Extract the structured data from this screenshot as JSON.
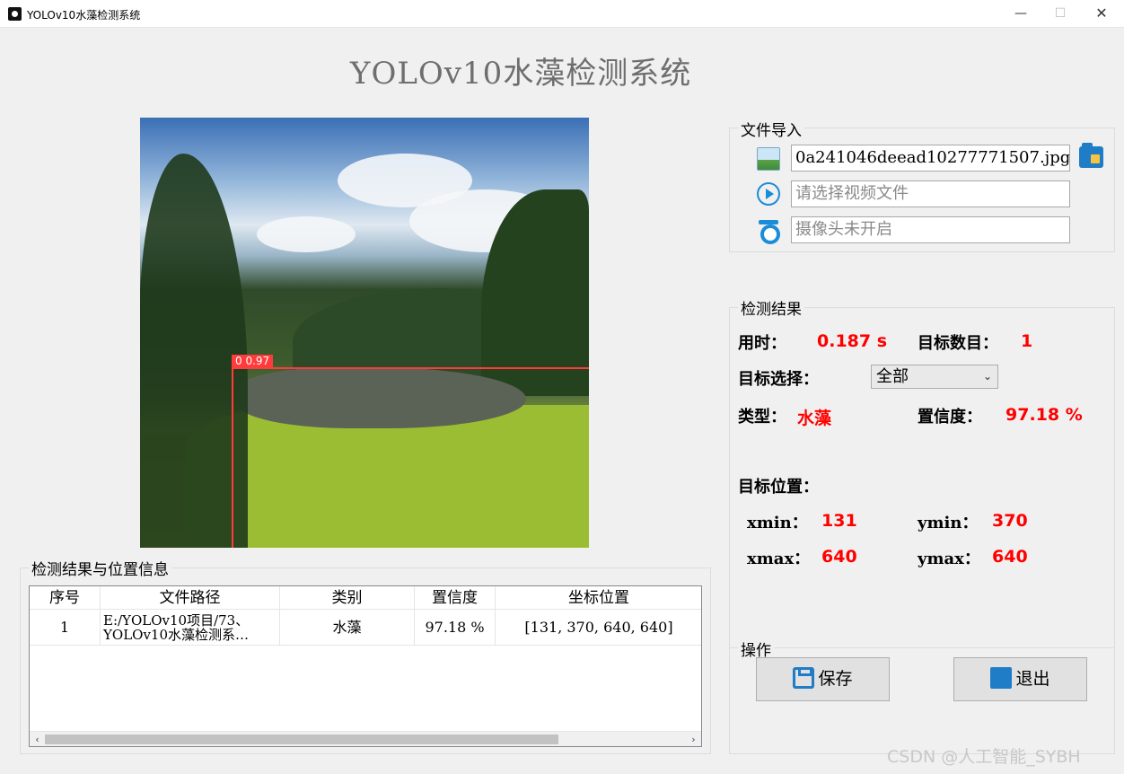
{
  "window": {
    "title": "YOLOv10水藻检测系统",
    "min": "—",
    "max": "☐",
    "close": "✕"
  },
  "app_title": "YOLOv10水藻检测系统",
  "image": {
    "bbox_label": "0 0.97"
  },
  "file_import": {
    "title": "文件导入",
    "image_path": "0a241046deead10277771507.jpg",
    "video_placeholder": "请选择视频文件",
    "camera_placeholder": "摄像头未开启"
  },
  "detection": {
    "title": "检测结果",
    "time_label": "用时：",
    "time_value": "0.187 s",
    "count_label": "目标数目：",
    "count_value": "1",
    "select_label": "目标选择：",
    "select_value": "全部",
    "type_label": "类型：",
    "type_value": "水藻",
    "conf_label": "置信度：",
    "conf_value": "97.18 %",
    "pos_label": "目标位置：",
    "xmin_label": "xmin：",
    "xmin_value": "131",
    "ymin_label": "ymin：",
    "ymin_value": "370",
    "xmax_label": "xmax：",
    "xmax_value": "640",
    "ymax_label": "ymax：",
    "ymax_value": "640"
  },
  "actions": {
    "title": "操作",
    "save": "保存",
    "exit": "退出"
  },
  "table": {
    "title": "检测结果与位置信息",
    "headers": [
      "序号",
      "文件路径",
      "类别",
      "置信度",
      "坐标位置"
    ],
    "rows": [
      {
        "index": "1",
        "path_line1": "E:/YOLOv10项目/73、",
        "path_line2": "YOLOv10水藻检测系…",
        "category": "水藻",
        "confidence": "97.18 %",
        "coords": "[131, 370, 640, 640]"
      }
    ]
  },
  "watermark": "CSDN @人工智能_SYBH",
  "colors": {
    "accent": "#1f7cc7",
    "value_red": "#ff0000",
    "bbox": "#ff3b3b"
  }
}
